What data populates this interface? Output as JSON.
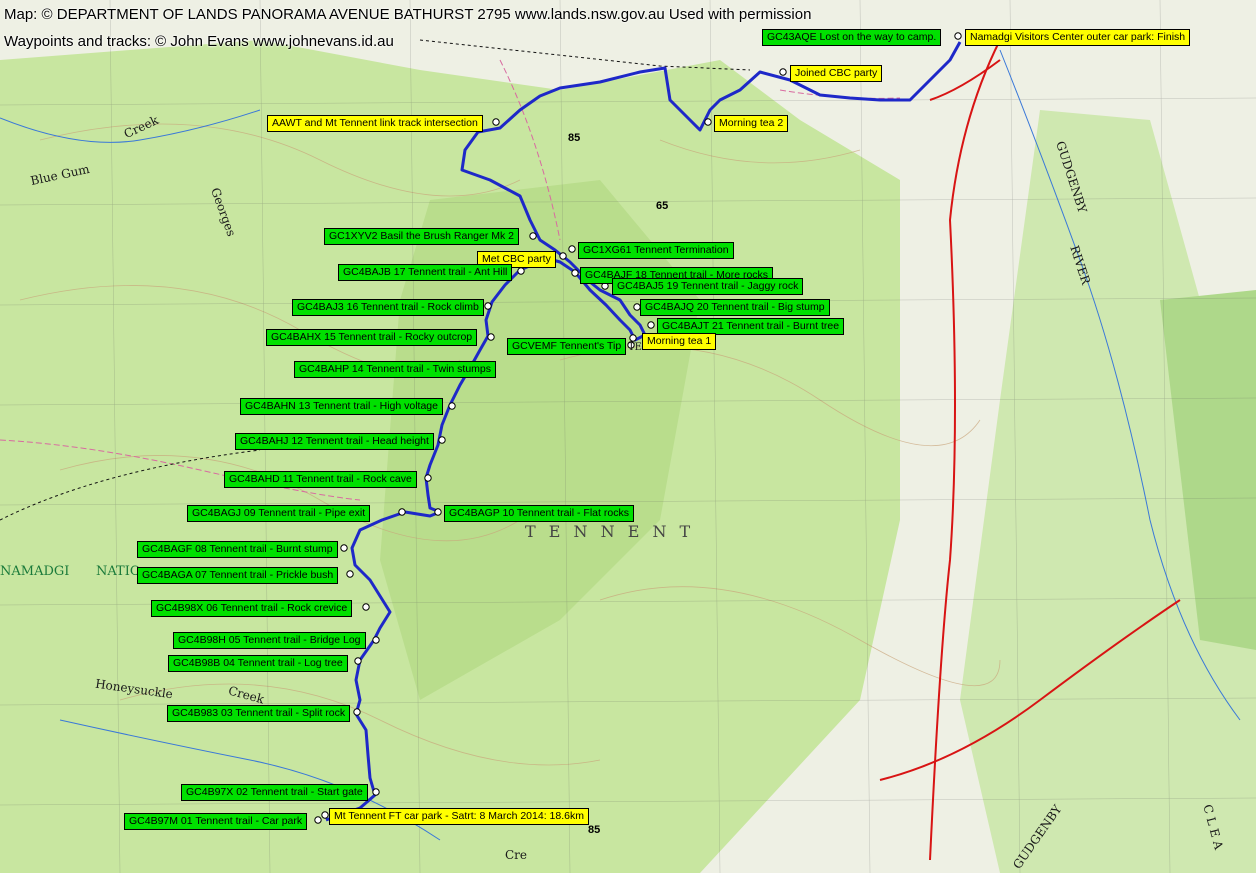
{
  "credits": {
    "map": "Map: © DEPARTMENT OF LANDS PANORAMA AVENUE BATHURST 2795 www.lands.nsw.gov.au  Used with permission",
    "tracks": "Waypoints and tracks: © John Evans www.johnevans.id.au"
  },
  "colors": {
    "green_label": "#00e000",
    "yellow_label": "#ffff00",
    "track": "#1e28c8",
    "road": "#d81414",
    "terrain": "#c8e6a0"
  },
  "waypoints": [
    {
      "id": "gc43aqe",
      "text": "GC43AQE Lost on the way to camp.",
      "style": "g"
    },
    {
      "id": "visitors",
      "text": "Namadgi Visitors Center outer car park: Finish",
      "style": "y"
    },
    {
      "id": "joined",
      "text": "Joined CBC party",
      "style": "y"
    },
    {
      "id": "aawt",
      "text": "AAWT and Mt Tennent link track intersection",
      "style": "y"
    },
    {
      "id": "mt2",
      "text": "Morning tea 2",
      "style": "y"
    },
    {
      "id": "gc1xyv2",
      "text": "GC1XYV2 Basil the Brush Ranger Mk 2",
      "style": "g"
    },
    {
      "id": "gc1xg61",
      "text": "GC1XG61 Tennent Termination",
      "style": "g"
    },
    {
      "id": "metcbc",
      "text": "Met CBC party",
      "style": "y"
    },
    {
      "id": "gc4bajb",
      "text": "GC4BAJB 17 Tennent trail - Ant Hill",
      "style": "g"
    },
    {
      "id": "gc4bajf",
      "text": "GC4BAJF 18 Tennent trail - More rocks",
      "style": "g"
    },
    {
      "id": "gc4baj5",
      "text": "GC4BAJ5 19 Tennent trail - Jaggy rock",
      "style": "g"
    },
    {
      "id": "gc4baj3",
      "text": "GC4BAJ3 16 Tennent trail - Rock climb",
      "style": "g"
    },
    {
      "id": "gc4bajq",
      "text": "GC4BAJQ 20 Tennent trail - Big stump",
      "style": "g"
    },
    {
      "id": "gc4bajt",
      "text": "GC4BAJT 21 Tennent trail - Burnt tree",
      "style": "g"
    },
    {
      "id": "gc4bahx",
      "text": "GC4BAHX 15 Tennent trail - Rocky outcrop",
      "style": "g"
    },
    {
      "id": "gcvemf",
      "text": "GCVEMF Tennent's Tip",
      "style": "g"
    },
    {
      "id": "mt1",
      "text": "Morning tea 1",
      "style": "y"
    },
    {
      "id": "gc4bahp",
      "text": "GC4BAHP 14 Tennent trail - Twin stumps",
      "style": "g"
    },
    {
      "id": "gc4bahn",
      "text": "GC4BAHN 13 Tennent trail - High voltage",
      "style": "g"
    },
    {
      "id": "gc4bahj",
      "text": "GC4BAHJ 12 Tennent trail - Head height",
      "style": "g"
    },
    {
      "id": "gc4bahd",
      "text": "GC4BAHD 11 Tennent trail - Rock cave",
      "style": "g"
    },
    {
      "id": "gc4bagj",
      "text": "GC4BAGJ 09 Tennent trail - Pipe exit",
      "style": "g"
    },
    {
      "id": "gc4bagp",
      "text": "GC4BAGP 10 Tennent trail - Flat rocks",
      "style": "g"
    },
    {
      "id": "gc4bagf",
      "text": "GC4BAGF 08 Tennent trail - Burnt stump",
      "style": "g"
    },
    {
      "id": "gc4baga",
      "text": "GC4BAGA 07 Tennent trail - Prickle bush",
      "style": "g"
    },
    {
      "id": "gc4b98x",
      "text": "GC4B98X 06 Tennent trail - Rock crevice",
      "style": "g"
    },
    {
      "id": "gc4b98h",
      "text": "GC4B98H 05 Tennent trail - Bridge Log",
      "style": "g"
    },
    {
      "id": "gc4b98b",
      "text": "GC4B98B 04 Tennent trail - Log tree",
      "style": "g"
    },
    {
      "id": "gc4b983",
      "text": "GC4B983 03 Tennent trail - Split rock",
      "style": "g"
    },
    {
      "id": "gc4b97x",
      "text": "GC4B97X 02 Tennent trail - Start gate",
      "style": "g"
    },
    {
      "id": "gc4b97m",
      "text": "GC4B97M 01 Tennent trail - Car park",
      "style": "g"
    },
    {
      "id": "carpark",
      "text": "Mt Tennent FT car park - Satrt: 8 March 2014: 18.6km",
      "style": "y"
    }
  ],
  "map_text": {
    "tennent": "T E N N E N T",
    "tennent_summit": "TENNENT",
    "namadgi": "NAMADGI",
    "natio": "NATIO",
    "creek_top": "Creek",
    "blue_gum": "Blue  Gum",
    "georges": "Georges",
    "cre": "Cre",
    "honeysuckle": "Honeysuckle",
    "creek_bottom": "Creek",
    "gudgenby_river": "GUDGENBY",
    "river": "RIVER",
    "gudgenby_bottom": "GUDGENBY",
    "clear": "C L E A",
    "grid_85_top": "85",
    "grid_65": "65",
    "grid_85_bottom": "85"
  }
}
